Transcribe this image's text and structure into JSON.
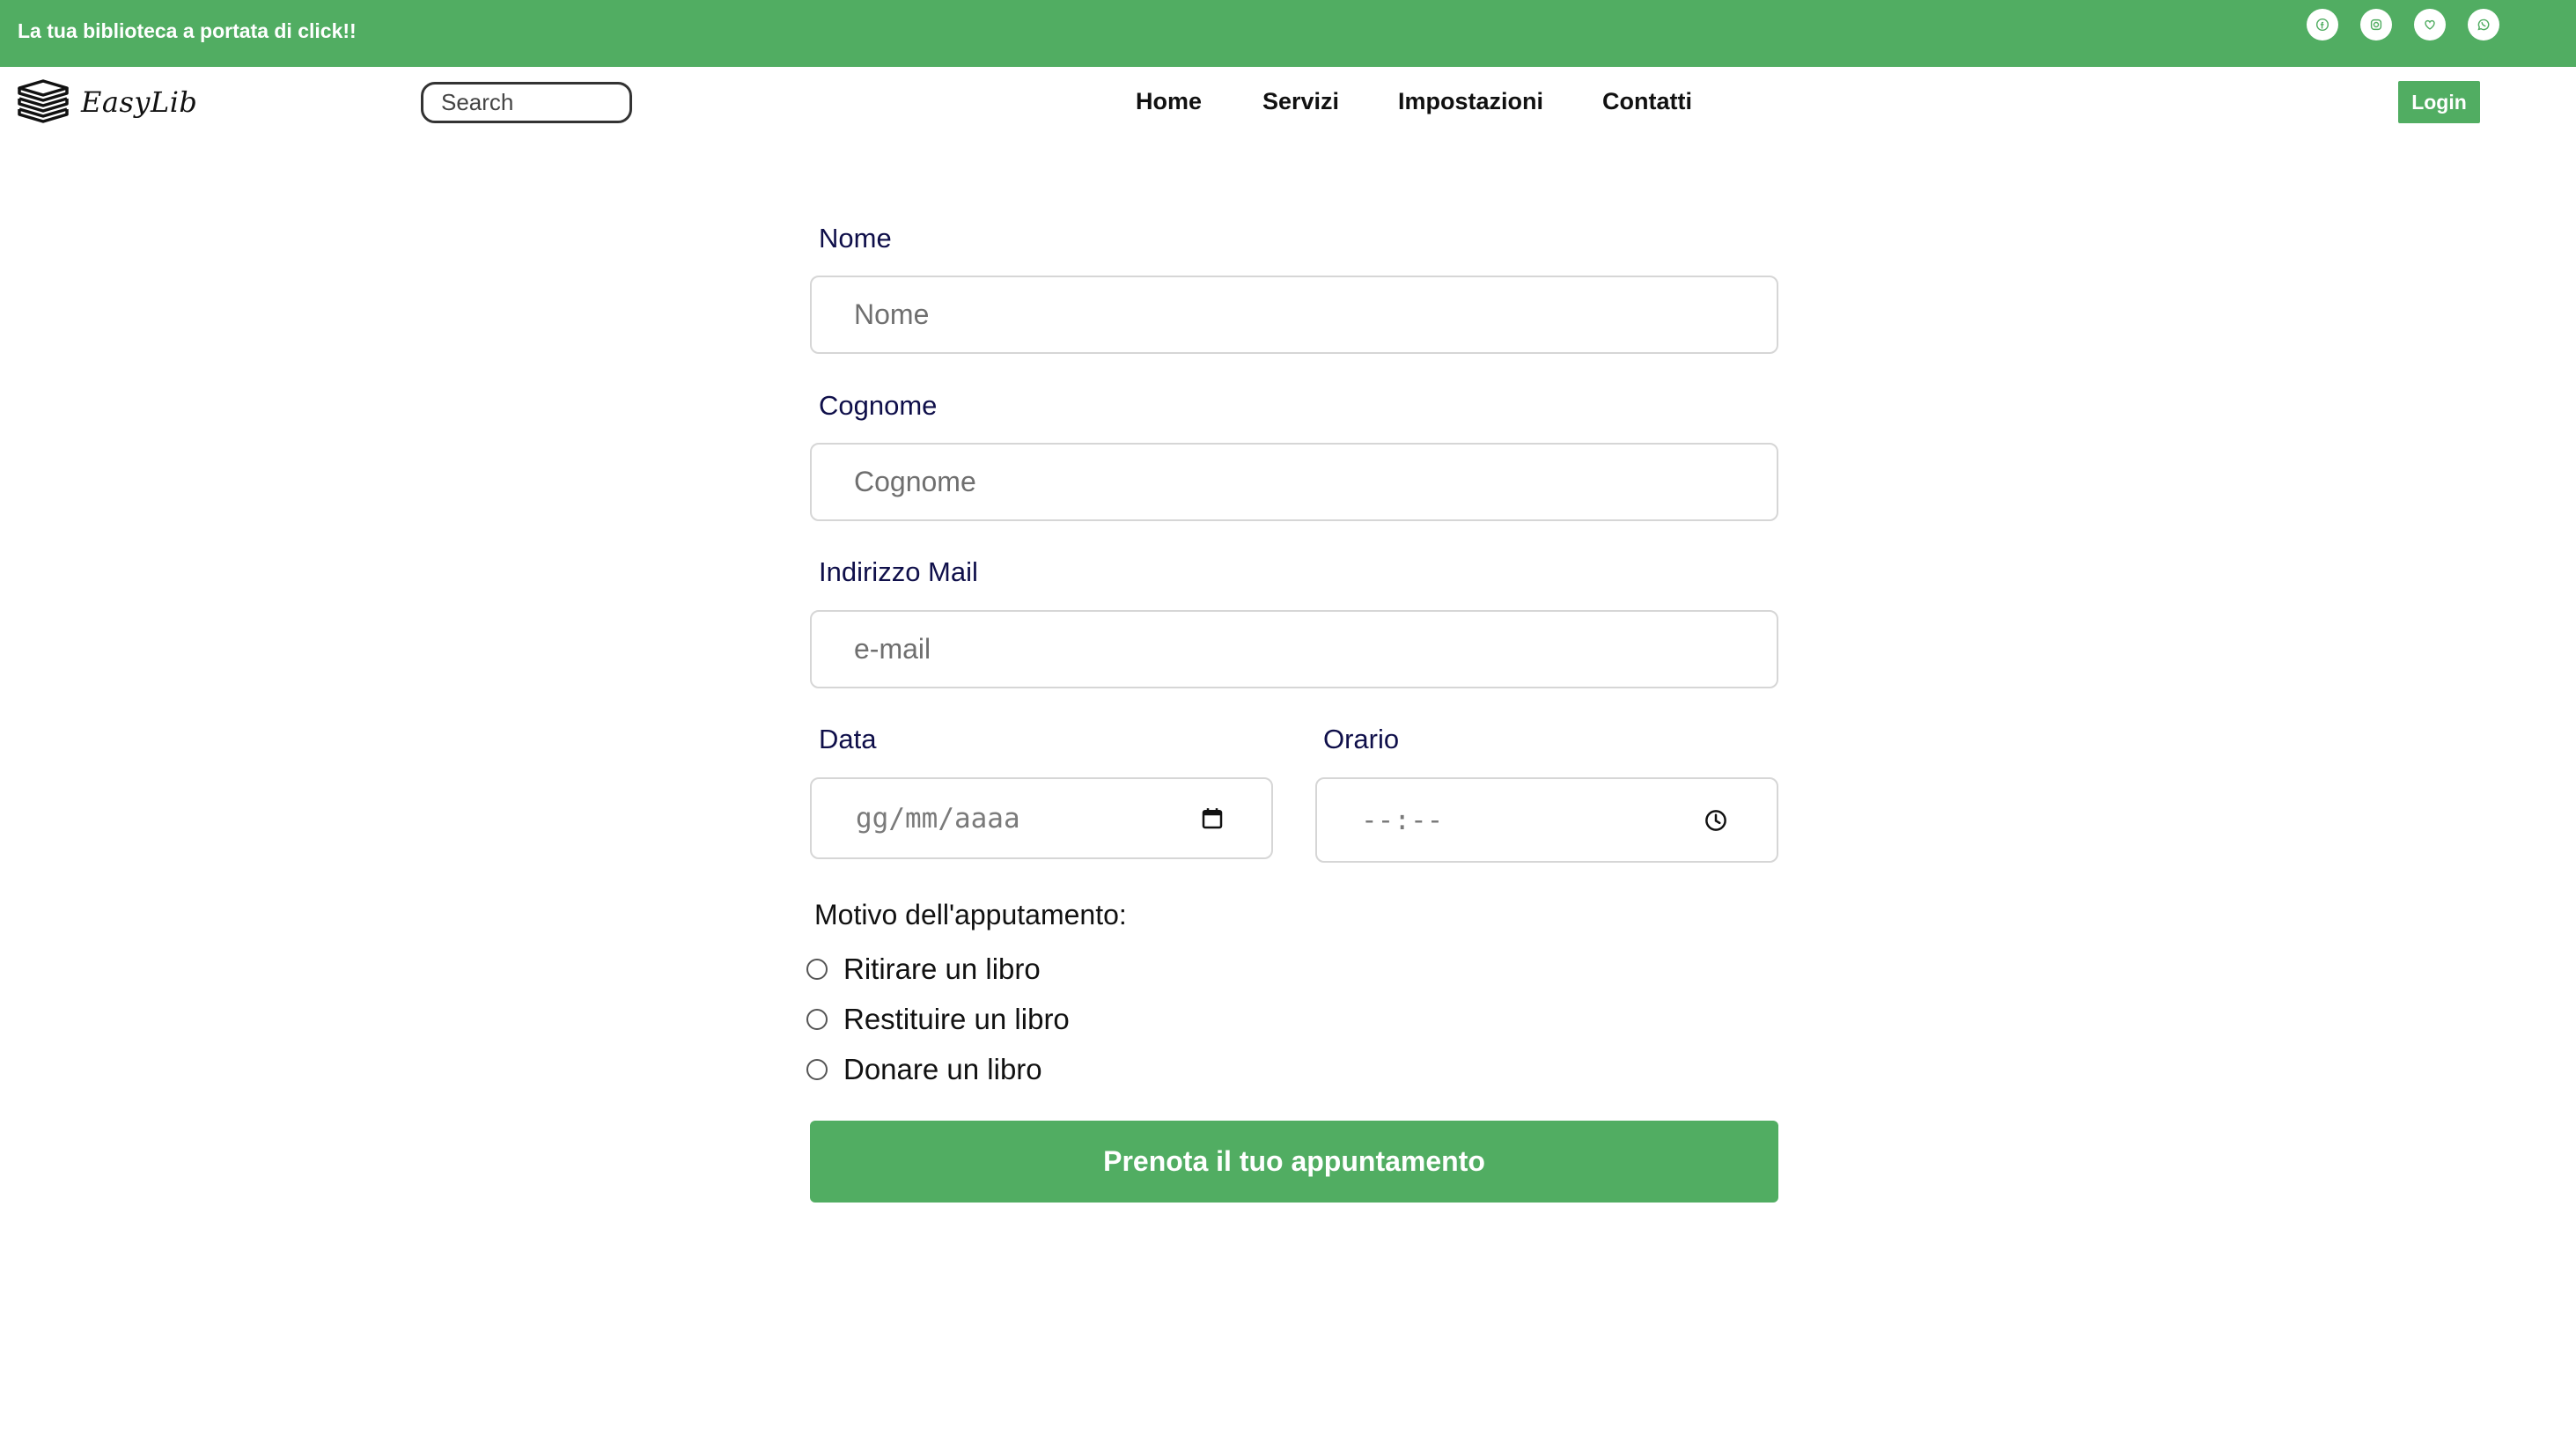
{
  "topbar": {
    "tagline": "La tua biblioteca a portata di click!!",
    "social_icons": [
      "facebook-icon",
      "instagram-icon",
      "heart-icon",
      "whatsapp-icon"
    ]
  },
  "navbar": {
    "logo_text": "EasyLib",
    "search_placeholder": "Search",
    "links": [
      "Home",
      "Servizi",
      "Impostazioni",
      "Contatti"
    ],
    "login_label": "Login"
  },
  "form": {
    "nome_label": "Nome",
    "nome_placeholder": "Nome",
    "cognome_label": "Cognome",
    "cognome_placeholder": "Cognome",
    "email_label": "Indirizzo Mail",
    "email_placeholder": "e-mail",
    "data_label": "Data",
    "data_placeholder": "gg/mm/aaaa",
    "orario_label": "Orario",
    "orario_placeholder": "--:--",
    "motivo_label": "Motivo dell'apputamento:",
    "options": [
      "Ritirare un libro",
      "Restituire un libro",
      "Donare un libro"
    ],
    "submit_label": "Prenota il tuo appuntamento"
  },
  "colors": {
    "brand_green": "#51ad62",
    "label_navy": "#0f0f4a",
    "border_gray": "#d6d6d6"
  }
}
